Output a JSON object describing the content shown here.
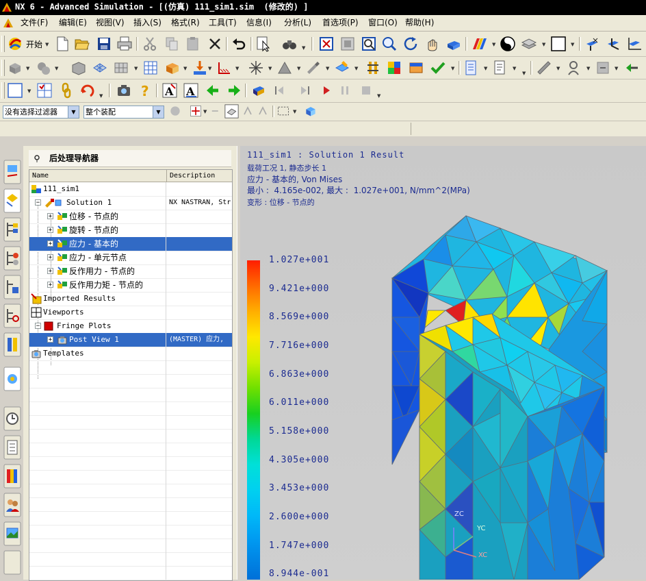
{
  "window": {
    "title": "NX 6 - Advanced Simulation - [(仿真) 111_sim1.sim  (修改的) ]"
  },
  "menu": [
    "文件(F)",
    "编辑(E)",
    "视图(V)",
    "插入(S)",
    "格式(R)",
    "工具(T)",
    "信息(I)",
    "分析(L)",
    "首选项(P)",
    "窗口(O)",
    "帮助(H)"
  ],
  "toolbar": {
    "start_label": "开始"
  },
  "filters": {
    "selection_filter": "没有选择过滤器",
    "scope": "整个装配"
  },
  "navigator": {
    "title": "后处理导航器",
    "columns": [
      "Name",
      "Description"
    ],
    "rows": [
      {
        "label": "111_sim1",
        "desc": ""
      },
      {
        "label": "Solution 1",
        "desc": "NX NASTRAN, Str"
      },
      {
        "label": "位移 - 节点的",
        "desc": ""
      },
      {
        "label": "旋转 - 节点的",
        "desc": ""
      },
      {
        "label": "应力 - 基本的",
        "desc": ""
      },
      {
        "label": "应力 - 单元节点",
        "desc": ""
      },
      {
        "label": "反作用力 - 节点的",
        "desc": ""
      },
      {
        "label": "反作用力矩 - 节点的",
        "desc": ""
      },
      {
        "label": "Imported Results",
        "desc": ""
      },
      {
        "label": "Viewports",
        "desc": ""
      },
      {
        "label": "Fringe Plots",
        "desc": ""
      },
      {
        "label": "Post View 1",
        "desc": "(MASTER) 应力,"
      },
      {
        "label": "Templates",
        "desc": ""
      }
    ]
  },
  "viewport": {
    "header": "111_sim1 : Solution 1 Result",
    "load_case": "载荷工况 1, 静态步长 1",
    "stress": "应力 - 基本的, Von Mises",
    "minmax": "最小 :  4.165e-002, 最大 :  1.027e+001, N/mm^2(MPa)",
    "deform": "变形 : 位移 - 节点的",
    "legend": [
      "1.027e+001",
      "9.421e+000",
      "8.569e+000",
      "7.716e+000",
      "6.863e+000",
      "6.011e+000",
      "5.158e+000",
      "4.305e+000",
      "3.453e+000",
      "2.600e+000",
      "1.747e+000",
      "8.944e-001"
    ],
    "triad": {
      "z": "ZC",
      "y": "YC",
      "x": "XC"
    }
  },
  "colors": {
    "title_bg": "#000000",
    "selection": "#316ac5",
    "legend_text": "#1a2a90"
  }
}
